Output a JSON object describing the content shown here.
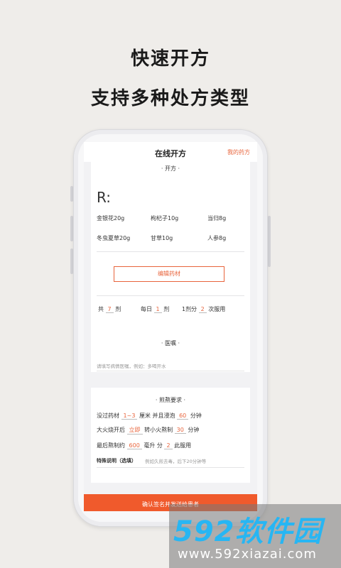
{
  "headline": {
    "line1": "快速开方",
    "line2": "支持多种处方类型"
  },
  "app": {
    "title": "在线开方",
    "my_prescriptions": "我的药方"
  },
  "prescription": {
    "section": "· 开方 ·",
    "rx": "R:",
    "herbs": [
      {
        "name": "金银花20g"
      },
      {
        "name": "枸杞子10g"
      },
      {
        "name": "当归8g"
      },
      {
        "name": "冬虫夏草20g"
      },
      {
        "name": "甘草10g"
      },
      {
        "name": "人参8g"
      }
    ],
    "edit_button": "编辑药材",
    "dosage": {
      "total_prefix": "共",
      "total": "7",
      "total_unit": "剂",
      "daily_prefix": "每日",
      "daily": "1",
      "daily_unit": "剂",
      "split_prefix": "1剂分",
      "split": "2",
      "split_unit": "次服用"
    }
  },
  "advice": {
    "section": "· 医嘱 ·",
    "placeholder": "请填写病情医嘱，例如：多喝开水"
  },
  "decoction": {
    "section": "·     煎熬要求     ·",
    "line1": {
      "a": "没过药材",
      "v1": "1~3",
      "b": "厘米",
      "c": "并且浸泡",
      "v2": "60",
      "d": "分钟"
    },
    "line2": {
      "a": "大火烧开后",
      "v1": "立即",
      "b": "转小火熬制",
      "v2": "30",
      "c": "分钟"
    },
    "line3": {
      "a": "最后熬制约",
      "v1": "600",
      "b": "毫升",
      "c": "分",
      "v2": "2",
      "d": "此服用"
    },
    "special_label": "特殊说明（选填）",
    "special_placeholder": "例如久煎去毒，后下20分钟等"
  },
  "confirm_button": "确认签名并发送给患者",
  "watermark": {
    "brand": "592软件园",
    "url": "www.592xiazai.com"
  },
  "colors": {
    "accent": "#e8643c",
    "confirm": "#f05a2c",
    "background": "#efedea"
  }
}
